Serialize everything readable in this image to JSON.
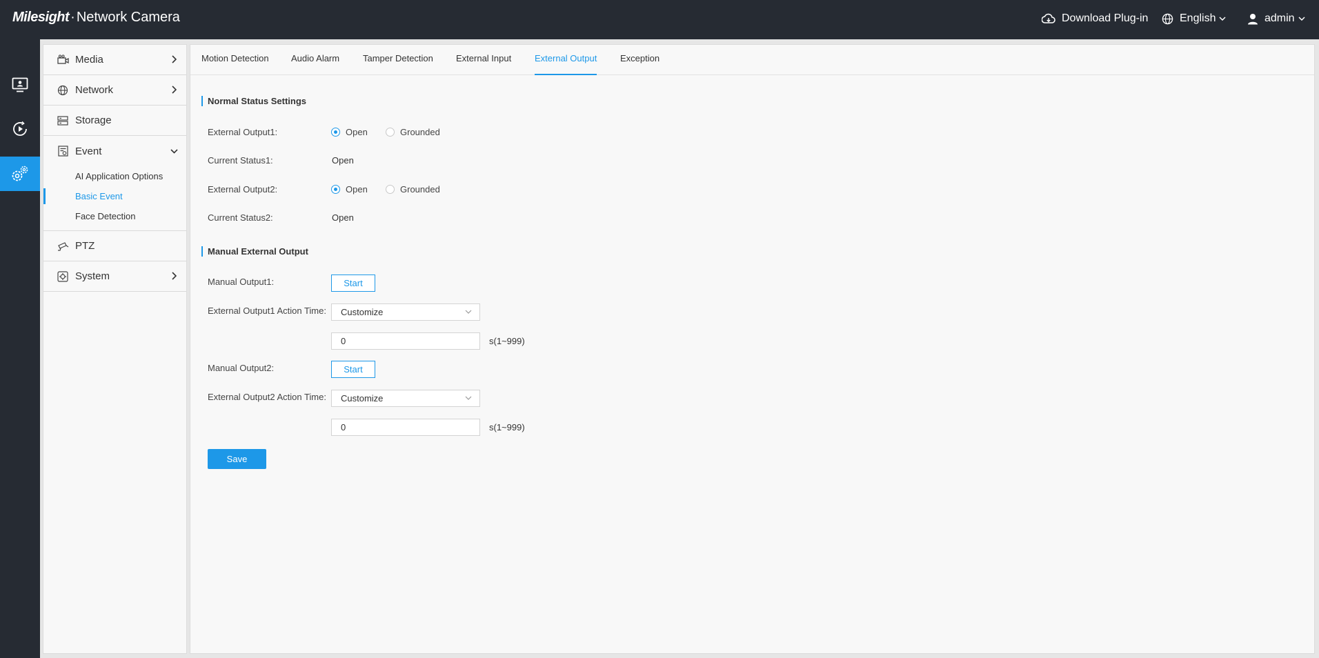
{
  "header": {
    "brand": "Milesight",
    "product": "Network Camera",
    "download_label": "Download Plug-in",
    "language": "English",
    "user": "admin"
  },
  "rail": {
    "items": [
      {
        "icon": "live-view-icon",
        "active": false
      },
      {
        "icon": "playback-icon",
        "active": false
      },
      {
        "icon": "settings-icon",
        "active": true
      }
    ]
  },
  "sidebar": {
    "items": [
      {
        "label": "Media",
        "icon": "camera-icon"
      },
      {
        "label": "Network",
        "icon": "globe-icon"
      },
      {
        "label": "Storage",
        "icon": "storage-icon"
      },
      {
        "label": "Event",
        "icon": "event-icon"
      },
      {
        "label": "PTZ",
        "icon": "ptz-icon"
      },
      {
        "label": "System",
        "icon": "system-icon"
      }
    ],
    "event_sub": [
      {
        "label": "AI Application Options"
      },
      {
        "label": "Basic Event"
      },
      {
        "label": "Face Detection"
      }
    ]
  },
  "tabs": [
    {
      "label": "Motion Detection"
    },
    {
      "label": "Audio Alarm"
    },
    {
      "label": "Tamper Detection"
    },
    {
      "label": "External Input"
    },
    {
      "label": "External Output"
    },
    {
      "label": "Exception"
    }
  ],
  "normal_status": {
    "title": "Normal Status Settings",
    "output1_label": "External Output1:",
    "status1_label": "Current Status1:",
    "status1_value": "Open",
    "output2_label": "External Output2:",
    "status2_label": "Current Status2:",
    "status2_value": "Open",
    "opt_open": "Open",
    "opt_grounded": "Grounded",
    "output1_selected": "Open",
    "output2_selected": "Open"
  },
  "manual": {
    "title": "Manual External Output",
    "manual1_label": "Manual Output1:",
    "start_label": "Start",
    "action1_label": "External Output1 Action Time:",
    "action1_value": "Customize",
    "time1_value": "0",
    "unit": "s(1~999)",
    "manual2_label": "Manual Output2:",
    "action2_label": "External Output2 Action Time:",
    "action2_value": "Customize",
    "time2_value": "0"
  },
  "save_label": "Save",
  "colors": {
    "accent": "#1d98e8",
    "topbar": "#262b33"
  }
}
